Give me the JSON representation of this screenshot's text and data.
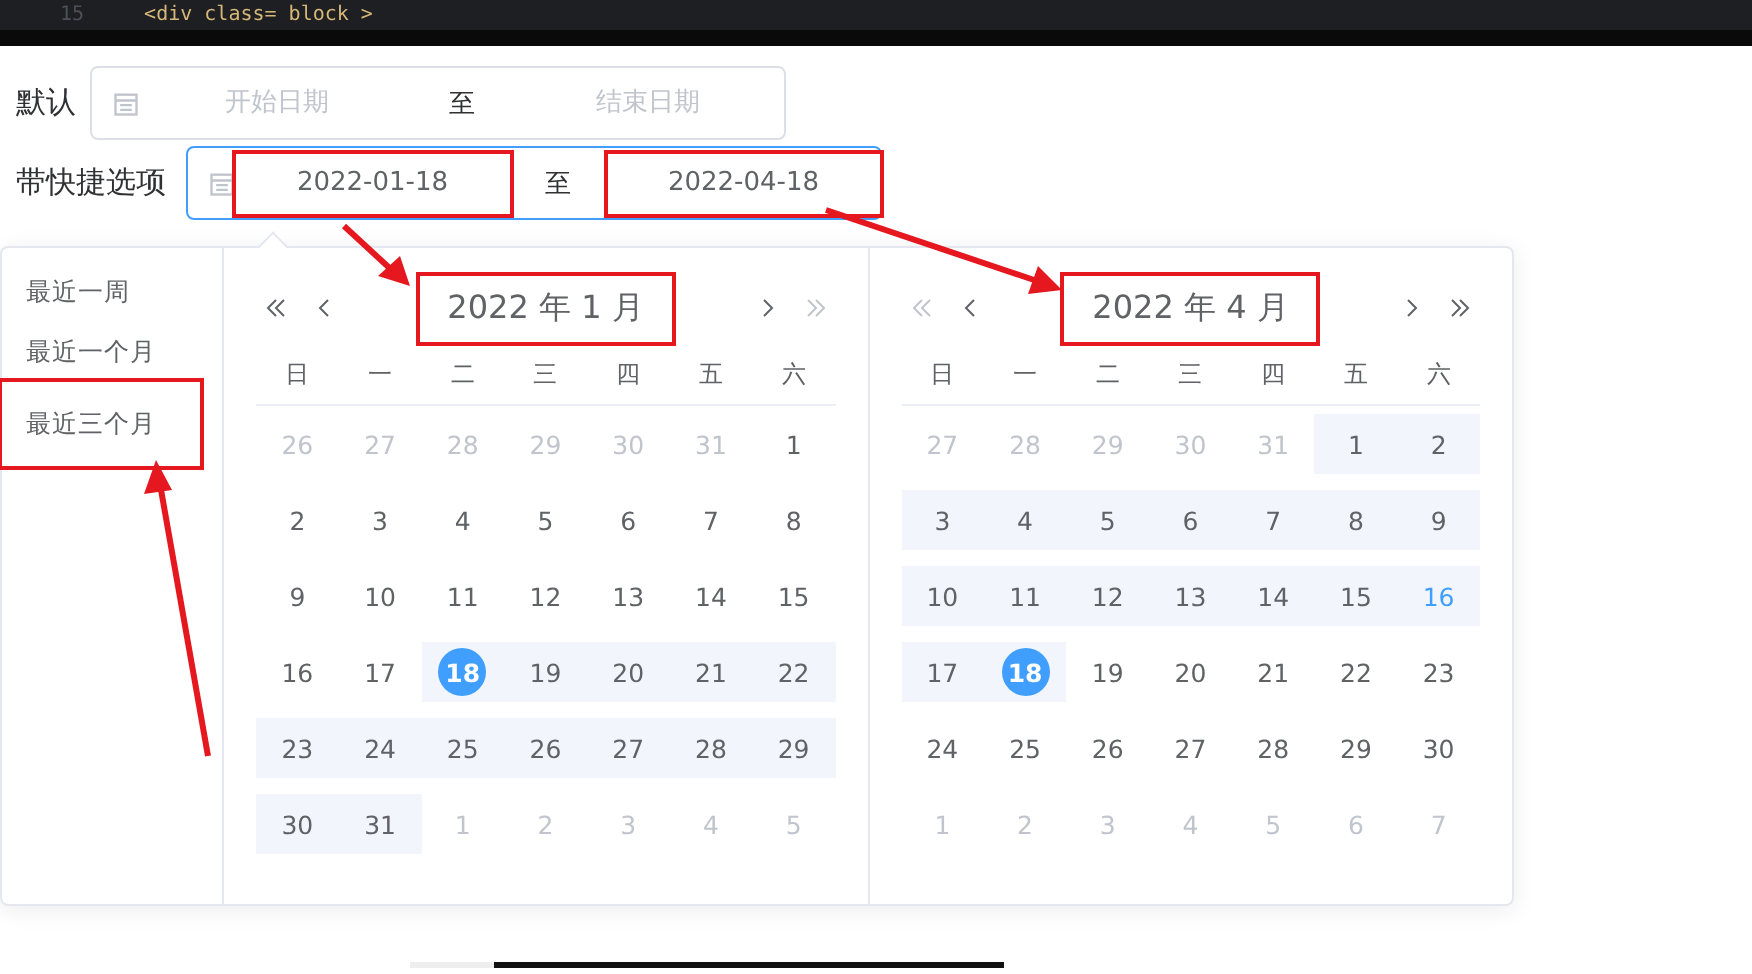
{
  "editor_strip": {
    "line_number": "15",
    "code": "<div class= block >"
  },
  "rows": [
    {
      "label": "默认",
      "start": {
        "placeholder": "开始日期",
        "annotated": false
      },
      "separator": "至",
      "end": {
        "placeholder": "结束日期",
        "annotated": false
      },
      "focused": false
    },
    {
      "label": "带快捷选项",
      "start": {
        "value": "2022-01-18",
        "annotated": true
      },
      "separator": "至",
      "end": {
        "value": "2022-04-18",
        "annotated": true
      },
      "focused": true
    }
  ],
  "shortcuts": [
    {
      "label": "最近一周",
      "annotated": false
    },
    {
      "label": "最近一个月",
      "annotated": false
    },
    {
      "label": "最近三个月",
      "annotated": true
    }
  ],
  "calendars": [
    {
      "title": "2022 年 1 月",
      "title_annotated": true,
      "nav": [
        {
          "kind": "prev_year",
          "disabled": false
        },
        {
          "kind": "prev_month",
          "disabled": false
        },
        {
          "kind": "next_month",
          "disabled": false
        },
        {
          "kind": "next_year",
          "disabled": true
        }
      ],
      "weekdays": [
        "日",
        "一",
        "二",
        "三",
        "四",
        "五",
        "六"
      ],
      "weeks": [
        [
          {
            "text": "26",
            "kind": "prev",
            "in_range": false,
            "selected": false
          },
          {
            "text": "27",
            "kind": "prev",
            "in_range": false,
            "selected": false
          },
          {
            "text": "28",
            "kind": "prev",
            "in_range": false,
            "selected": false
          },
          {
            "text": "29",
            "kind": "prev",
            "in_range": false,
            "selected": false
          },
          {
            "text": "30",
            "kind": "prev",
            "in_range": false,
            "selected": false
          },
          {
            "text": "31",
            "kind": "prev",
            "in_range": false,
            "selected": false
          },
          {
            "text": "1",
            "kind": "current",
            "in_range": false,
            "selected": false
          }
        ],
        [
          {
            "text": "2",
            "kind": "current",
            "in_range": false,
            "selected": false
          },
          {
            "text": "3",
            "kind": "current",
            "in_range": false,
            "selected": false
          },
          {
            "text": "4",
            "kind": "current",
            "in_range": false,
            "selected": false
          },
          {
            "text": "5",
            "kind": "current",
            "in_range": false,
            "selected": false
          },
          {
            "text": "6",
            "kind": "current",
            "in_range": false,
            "selected": false
          },
          {
            "text": "7",
            "kind": "current",
            "in_range": false,
            "selected": false
          },
          {
            "text": "8",
            "kind": "current",
            "in_range": false,
            "selected": false
          }
        ],
        [
          {
            "text": "9",
            "kind": "current",
            "in_range": false,
            "selected": false
          },
          {
            "text": "10",
            "kind": "current",
            "in_range": false,
            "selected": false
          },
          {
            "text": "11",
            "kind": "current",
            "in_range": false,
            "selected": false
          },
          {
            "text": "12",
            "kind": "current",
            "in_range": false,
            "selected": false
          },
          {
            "text": "13",
            "kind": "current",
            "in_range": false,
            "selected": false
          },
          {
            "text": "14",
            "kind": "current",
            "in_range": false,
            "selected": false
          },
          {
            "text": "15",
            "kind": "current",
            "in_range": false,
            "selected": false
          }
        ],
        [
          {
            "text": "16",
            "kind": "current",
            "in_range": false,
            "selected": false
          },
          {
            "text": "17",
            "kind": "current",
            "in_range": false,
            "selected": false
          },
          {
            "text": "18",
            "kind": "current",
            "in_range": true,
            "selected": true
          },
          {
            "text": "19",
            "kind": "current",
            "in_range": true,
            "selected": false
          },
          {
            "text": "20",
            "kind": "current",
            "in_range": true,
            "selected": false
          },
          {
            "text": "21",
            "kind": "current",
            "in_range": true,
            "selected": false
          },
          {
            "text": "22",
            "kind": "current",
            "in_range": true,
            "selected": false
          }
        ],
        [
          {
            "text": "23",
            "kind": "current",
            "in_range": true,
            "selected": false
          },
          {
            "text": "24",
            "kind": "current",
            "in_range": true,
            "selected": false
          },
          {
            "text": "25",
            "kind": "current",
            "in_range": true,
            "selected": false
          },
          {
            "text": "26",
            "kind": "current",
            "in_range": true,
            "selected": false
          },
          {
            "text": "27",
            "kind": "current",
            "in_range": true,
            "selected": false
          },
          {
            "text": "28",
            "kind": "current",
            "in_range": true,
            "selected": false
          },
          {
            "text": "29",
            "kind": "current",
            "in_range": true,
            "selected": false
          }
        ],
        [
          {
            "text": "30",
            "kind": "current",
            "in_range": true,
            "selected": false
          },
          {
            "text": "31",
            "kind": "current",
            "in_range": true,
            "selected": false
          },
          {
            "text": "1",
            "kind": "next",
            "in_range": false,
            "selected": false
          },
          {
            "text": "2",
            "kind": "next",
            "in_range": false,
            "selected": false
          },
          {
            "text": "3",
            "kind": "next",
            "in_range": false,
            "selected": false
          },
          {
            "text": "4",
            "kind": "next",
            "in_range": false,
            "selected": false
          },
          {
            "text": "5",
            "kind": "next",
            "in_range": false,
            "selected": false
          }
        ]
      ]
    },
    {
      "title": "2022 年 4 月",
      "title_annotated": true,
      "nav": [
        {
          "kind": "prev_year",
          "disabled": true
        },
        {
          "kind": "prev_month",
          "disabled": false
        },
        {
          "kind": "next_month",
          "disabled": false
        },
        {
          "kind": "next_year",
          "disabled": false
        }
      ],
      "weekdays": [
        "日",
        "一",
        "二",
        "三",
        "四",
        "五",
        "六"
      ],
      "weeks": [
        [
          {
            "text": "27",
            "kind": "prev",
            "in_range": false,
            "selected": false
          },
          {
            "text": "28",
            "kind": "prev",
            "in_range": false,
            "selected": false
          },
          {
            "text": "29",
            "kind": "prev",
            "in_range": false,
            "selected": false
          },
          {
            "text": "30",
            "kind": "prev",
            "in_range": false,
            "selected": false
          },
          {
            "text": "31",
            "kind": "prev",
            "in_range": false,
            "selected": false
          },
          {
            "text": "1",
            "kind": "current",
            "in_range": true,
            "selected": false
          },
          {
            "text": "2",
            "kind": "current",
            "in_range": true,
            "selected": false
          }
        ],
        [
          {
            "text": "3",
            "kind": "current",
            "in_range": true,
            "selected": false
          },
          {
            "text": "4",
            "kind": "current",
            "in_range": true,
            "selected": false
          },
          {
            "text": "5",
            "kind": "current",
            "in_range": true,
            "selected": false
          },
          {
            "text": "6",
            "kind": "current",
            "in_range": true,
            "selected": false
          },
          {
            "text": "7",
            "kind": "current",
            "in_range": true,
            "selected": false
          },
          {
            "text": "8",
            "kind": "current",
            "in_range": true,
            "selected": false
          },
          {
            "text": "9",
            "kind": "current",
            "in_range": true,
            "selected": false
          }
        ],
        [
          {
            "text": "10",
            "kind": "current",
            "in_range": true,
            "selected": false
          },
          {
            "text": "11",
            "kind": "current",
            "in_range": true,
            "selected": false
          },
          {
            "text": "12",
            "kind": "current",
            "in_range": true,
            "selected": false
          },
          {
            "text": "13",
            "kind": "current",
            "in_range": true,
            "selected": false
          },
          {
            "text": "14",
            "kind": "current",
            "in_range": true,
            "selected": false
          },
          {
            "text": "15",
            "kind": "current",
            "in_range": true,
            "selected": false
          },
          {
            "text": "16",
            "kind": "today",
            "in_range": true,
            "selected": false
          }
        ],
        [
          {
            "text": "17",
            "kind": "current",
            "in_range": true,
            "selected": false
          },
          {
            "text": "18",
            "kind": "current",
            "in_range": true,
            "selected": true
          },
          {
            "text": "19",
            "kind": "current",
            "in_range": false,
            "selected": false
          },
          {
            "text": "20",
            "kind": "current",
            "in_range": false,
            "selected": false
          },
          {
            "text": "21",
            "kind": "current",
            "in_range": false,
            "selected": false
          },
          {
            "text": "22",
            "kind": "current",
            "in_range": false,
            "selected": false
          },
          {
            "text": "23",
            "kind": "current",
            "in_range": false,
            "selected": false
          }
        ],
        [
          {
            "text": "24",
            "kind": "current",
            "in_range": false,
            "selected": false
          },
          {
            "text": "25",
            "kind": "current",
            "in_range": false,
            "selected": false
          },
          {
            "text": "26",
            "kind": "current",
            "in_range": false,
            "selected": false
          },
          {
            "text": "27",
            "kind": "current",
            "in_range": false,
            "selected": false
          },
          {
            "text": "28",
            "kind": "current",
            "in_range": false,
            "selected": false
          },
          {
            "text": "29",
            "kind": "current",
            "in_range": false,
            "selected": false
          },
          {
            "text": "30",
            "kind": "current",
            "in_range": false,
            "selected": false
          }
        ],
        [
          {
            "text": "1",
            "kind": "next",
            "in_range": false,
            "selected": false
          },
          {
            "text": "2",
            "kind": "next",
            "in_range": false,
            "selected": false
          },
          {
            "text": "3",
            "kind": "next",
            "in_range": false,
            "selected": false
          },
          {
            "text": "4",
            "kind": "next",
            "in_range": false,
            "selected": false
          },
          {
            "text": "5",
            "kind": "next",
            "in_range": false,
            "selected": false
          },
          {
            "text": "6",
            "kind": "next",
            "in_range": false,
            "selected": false
          },
          {
            "text": "7",
            "kind": "next",
            "in_range": false,
            "selected": false
          }
        ]
      ]
    }
  ]
}
